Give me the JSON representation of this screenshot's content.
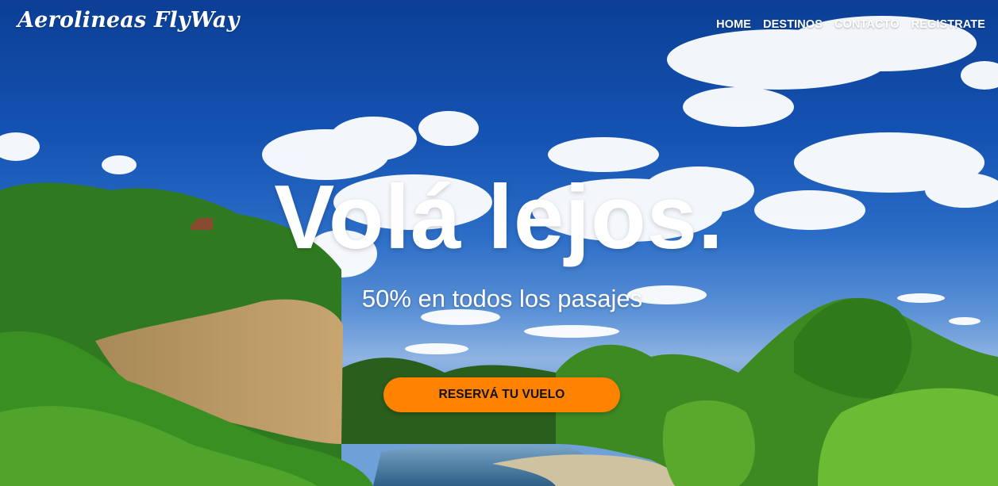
{
  "brand": {
    "name": "Aerolineas FlyWay"
  },
  "nav": {
    "items": [
      {
        "label": "HOME"
      },
      {
        "label": "DESTINOS"
      },
      {
        "label": "CONTACTO"
      },
      {
        "label": "REGISTRATE"
      }
    ]
  },
  "hero": {
    "headline": "Volá lejos.",
    "subheadline": "50% en todos los pasajes",
    "cta_label": "RESERVÁ TU VUELO"
  },
  "colors": {
    "accent": "#ff8200",
    "text": "#ffffff",
    "sky": "#1553b3",
    "foliage": "#2f7d1e"
  }
}
